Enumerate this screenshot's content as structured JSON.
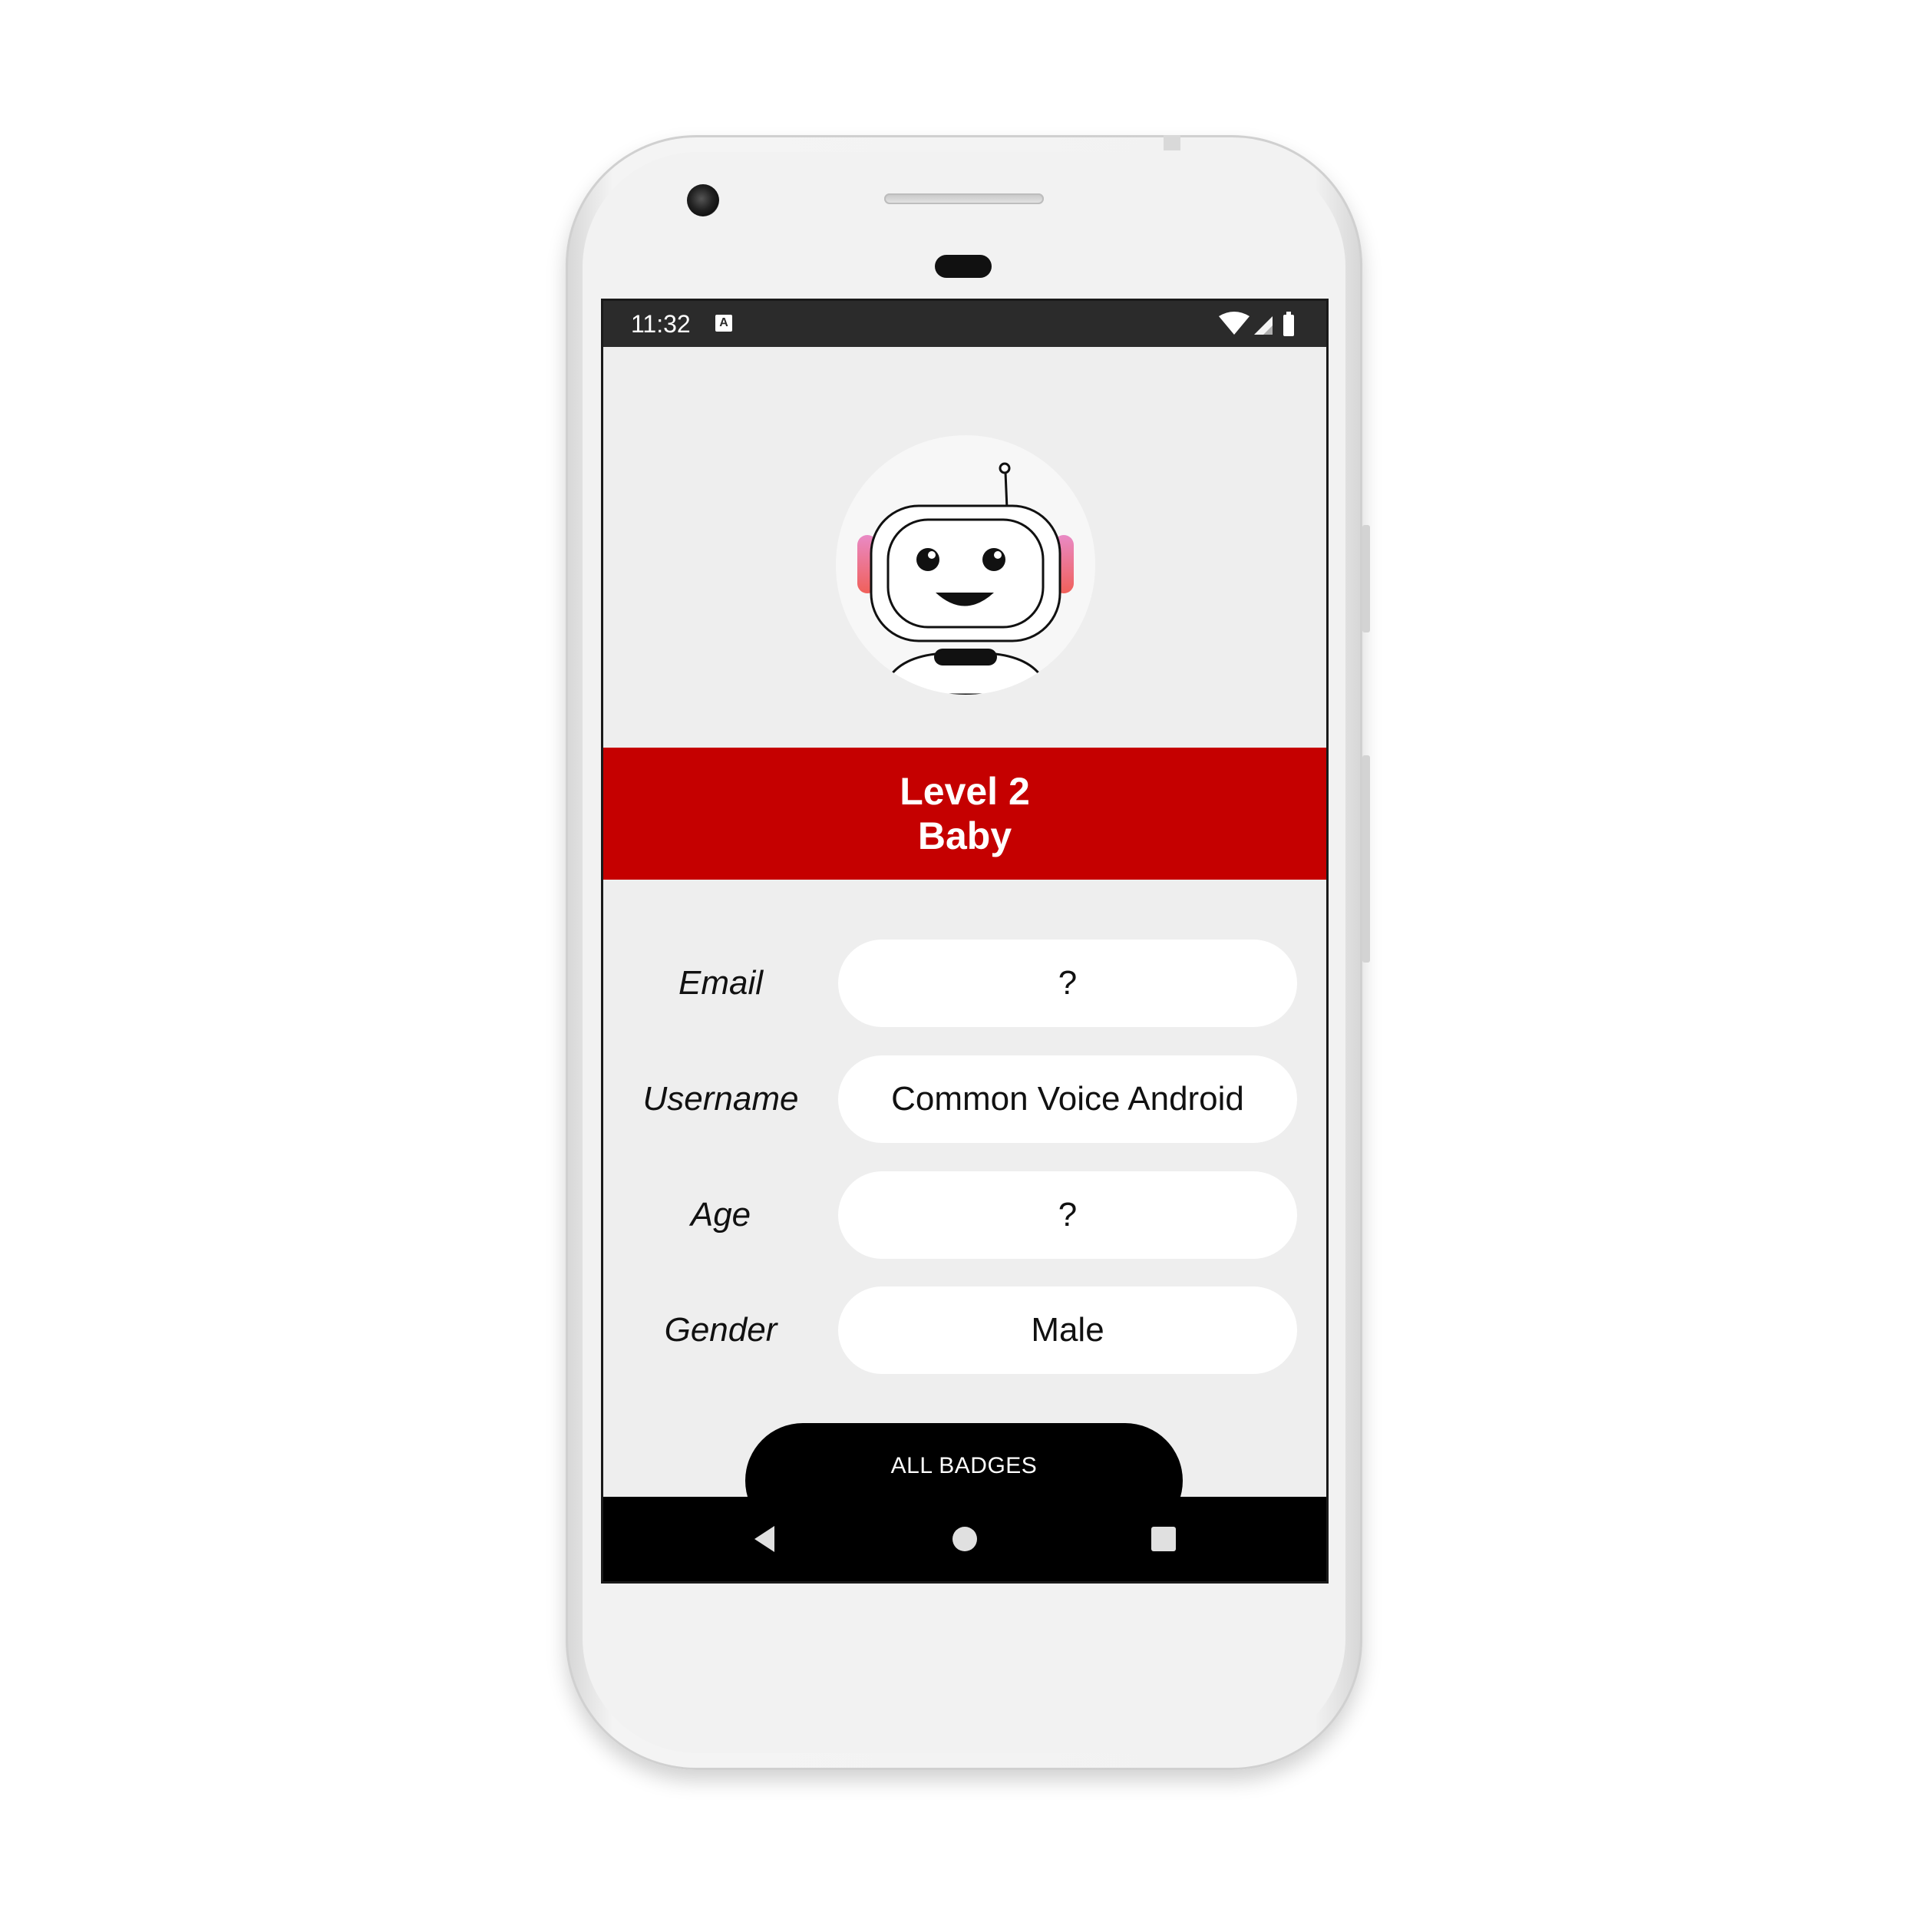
{
  "status_bar": {
    "time": "11:32",
    "notification_badge": "A",
    "icons": [
      "wifi-icon",
      "signal-icon",
      "battery-icon"
    ]
  },
  "profile": {
    "avatar_icon": "robot-avatar-icon",
    "level_label": "Level 2",
    "level_name": "Baby"
  },
  "fields": [
    {
      "label": "Email",
      "value": "?"
    },
    {
      "label": "Username",
      "value": "Common Voice Android"
    },
    {
      "label": "Age",
      "value": "?"
    },
    {
      "label": "Gender",
      "value": "Male"
    }
  ],
  "actions": {
    "all_badges_label": "ALL BADGES"
  },
  "nav_bar": {
    "icons": [
      "back-icon",
      "home-icon",
      "recents-icon"
    ]
  },
  "colors": {
    "accent": "#c50000",
    "screen_background": "#eeeeee",
    "field_background": "#ffffff",
    "button_background": "#000000"
  }
}
